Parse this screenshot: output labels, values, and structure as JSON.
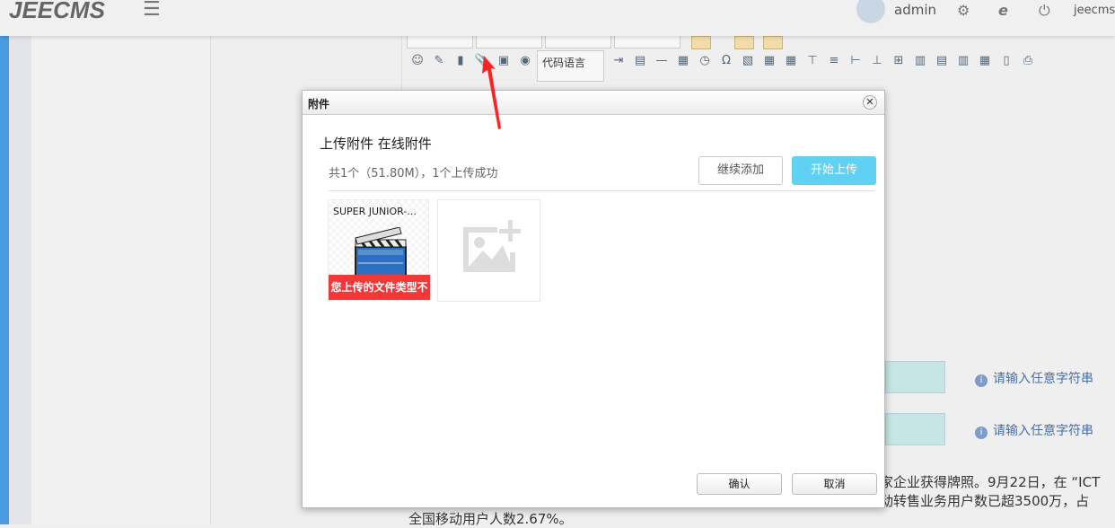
{
  "header": {
    "logo": "JEECMS",
    "user": "admin",
    "site": "jeecms"
  },
  "editor": {
    "code_language": "代码语言"
  },
  "form": {
    "hints": [
      "请输入任意字符串",
      "请输入任意字符串"
    ],
    "paragraph": [
      "家企业获得牌照。9月22日，在 “ICT",
      "动转售业务用户数已超3500万，占",
      "全国移动用户人数2.67%。"
    ]
  },
  "dialog": {
    "title": "附件",
    "tab_upload": "上传附件",
    "tab_online": "在线附件",
    "summary": "共1个（51.80M），1个上传成功",
    "continue_add": "继续添加",
    "start_upload": "开始上传",
    "file": {
      "name": "SUPER JUNIOR-...",
      "error": "您上传的文件类型不"
    },
    "ok": "确认",
    "cancel": "取消"
  }
}
